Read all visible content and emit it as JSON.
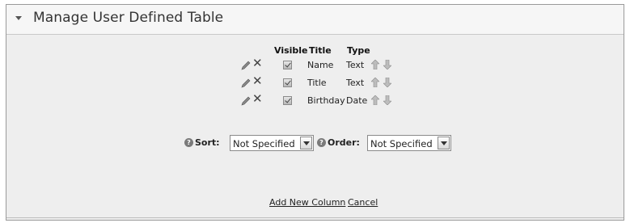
{
  "header": {
    "title": "Manage User Defined Table"
  },
  "columns": {
    "visible": "Visible",
    "title": "Title",
    "type": "Type"
  },
  "rows": [
    {
      "title": "Name",
      "type": "Text",
      "visible": true
    },
    {
      "title": "Title",
      "type": "Text",
      "visible": true
    },
    {
      "title": "Birthday",
      "type": "Date",
      "visible": true
    }
  ],
  "sort": {
    "label": "Sort:",
    "value": "Not Specified"
  },
  "order": {
    "label": "Order:",
    "value": "Not Specified"
  },
  "links": {
    "add_new_column": "Add New Column",
    "cancel": "Cancel"
  },
  "colors": {
    "panel_bg": "#eeeeee",
    "header_bg": "#f6f6f6",
    "border": "#9a9a9a"
  }
}
